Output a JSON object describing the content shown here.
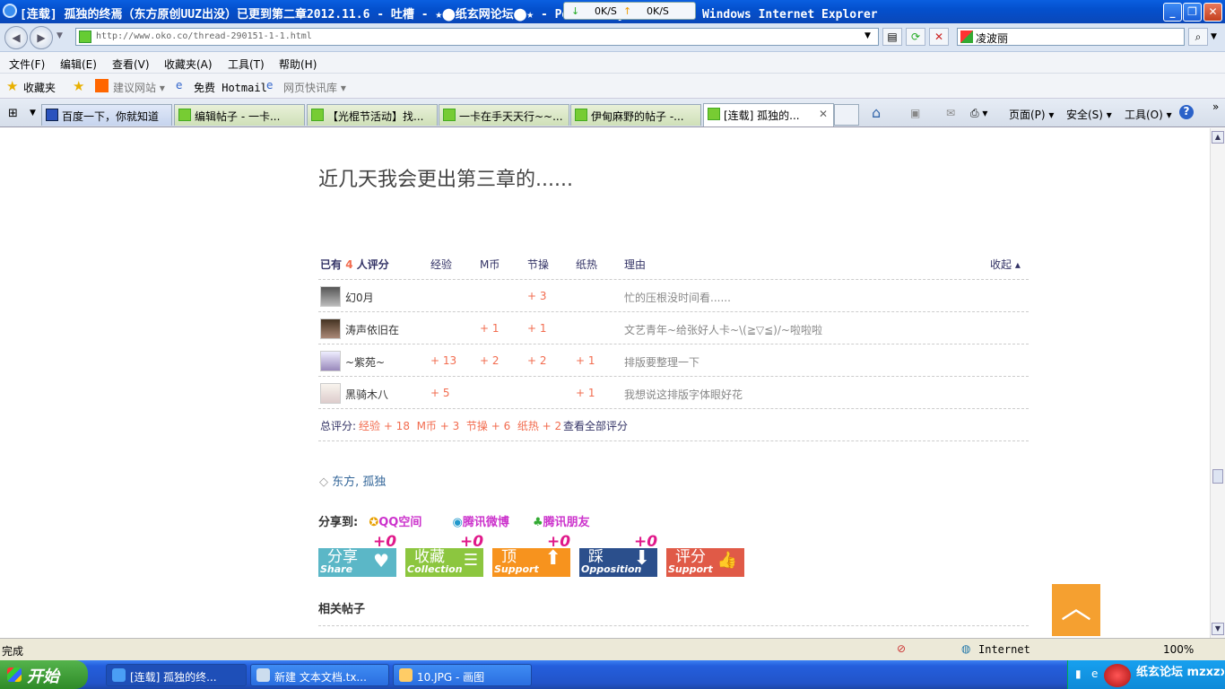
{
  "window": {
    "title": "[连载] 孤独的终焉（东方原创UUZ出没）已更到第二章2012.11.6 - 吐槽 - ★⬤纸玄网论坛⬤★ - Powered by Discuz! - Windows Internet Explorer",
    "min": "_",
    "max": "❐",
    "close": "✕"
  },
  "speed": {
    "down": "0K/S",
    "up": "0K/S"
  },
  "address": {
    "url": "http://www.oko.co/thread-290151-1-1.html",
    "search": "凌波丽"
  },
  "menu": [
    "文件(F)",
    "编辑(E)",
    "查看(V)",
    "收藏夹(A)",
    "工具(T)",
    "帮助(H)"
  ],
  "favbar": {
    "favorites": "收藏夹",
    "suggest": "建议网站 ▾",
    "hotmail": "免费 Hotmail",
    "slices": "网页快讯库 ▾"
  },
  "tabs": [
    "百度一下，你就知道",
    "编辑帖子 - 一卡...",
    "【光棍节活动】找...",
    "一卡在手天天行~~...",
    "伊甸麻野的帖子 -...",
    "[连载] 孤独的..."
  ],
  "tab_close": "✕",
  "cmdbar": {
    "page": "页面(P) ▾",
    "safety": "安全(S) ▾",
    "tools": "工具(O) ▾",
    "help": "?"
  },
  "post": {
    "text": "近几天我会更出第三章的......"
  },
  "rating": {
    "head": {
      "count_pre": "已有 ",
      "count": "4",
      "count_post": " 人评分",
      "col1": "经验",
      "col2": "M币",
      "col3": "节操",
      "col4": "纸热",
      "col5": "理由",
      "collapse": "收起 ▴"
    },
    "rows": [
      {
        "user": "幻0月",
        "exp": "",
        "coin": "",
        "jc": "+ 3",
        "hot": "",
        "reason": "忙的压根没时间看......"
      },
      {
        "user": "涛声依旧在",
        "exp": "",
        "coin": "+ 1",
        "jc": "+ 1",
        "hot": "",
        "reason": "文艺青年~给张好人卡~\\(≧▽≦)/~啦啦啦"
      },
      {
        "user": "~紫苑~",
        "exp": "+ 13",
        "coin": "+ 2",
        "jc": "+ 2",
        "hot": "+ 1",
        "reason": "排版要整理一下"
      },
      {
        "user": "黑骑木八",
        "exp": "+ 5",
        "coin": "",
        "jc": "",
        "hot": "+ 1",
        "reason": "我想说这排版字体眼好花"
      }
    ],
    "total_label": "总评分:",
    "total": "经验 + 18  M币 + 3  节操 + 6  纸热 + 2",
    "view_all": "查看全部评分"
  },
  "tags": "东方, 孤独",
  "share": {
    "label": "分享到:",
    "qzone": "QQ空间",
    "weibo": "腾讯微博",
    "pengyou": "腾讯朋友"
  },
  "actions": [
    {
      "cn": "分享",
      "en": "Share",
      "count": "+0",
      "color": "#5bb7c7"
    },
    {
      "cn": "收藏",
      "en": "Collection",
      "count": "+0",
      "color": "#8cc63f"
    },
    {
      "cn": "顶",
      "en": "Support",
      "count": "+0",
      "color": "#f7931e"
    },
    {
      "cn": "踩",
      "en": "Opposition",
      "count": "+0",
      "color": "#2b4f8c"
    },
    {
      "cn": "评分",
      "en": "Support",
      "count": "",
      "color": "#e05a47"
    }
  ],
  "related": "相关帖子",
  "status": {
    "left": "完成",
    "zone": "Internet",
    "zoom": "100%"
  },
  "taskbar": {
    "start": "开始",
    "items": [
      "[连载] 孤独的终...",
      "新建 文本文档.tx...",
      "10.JPG - 画图"
    ]
  },
  "watermark": "纸玄论坛 mzxzx.com"
}
